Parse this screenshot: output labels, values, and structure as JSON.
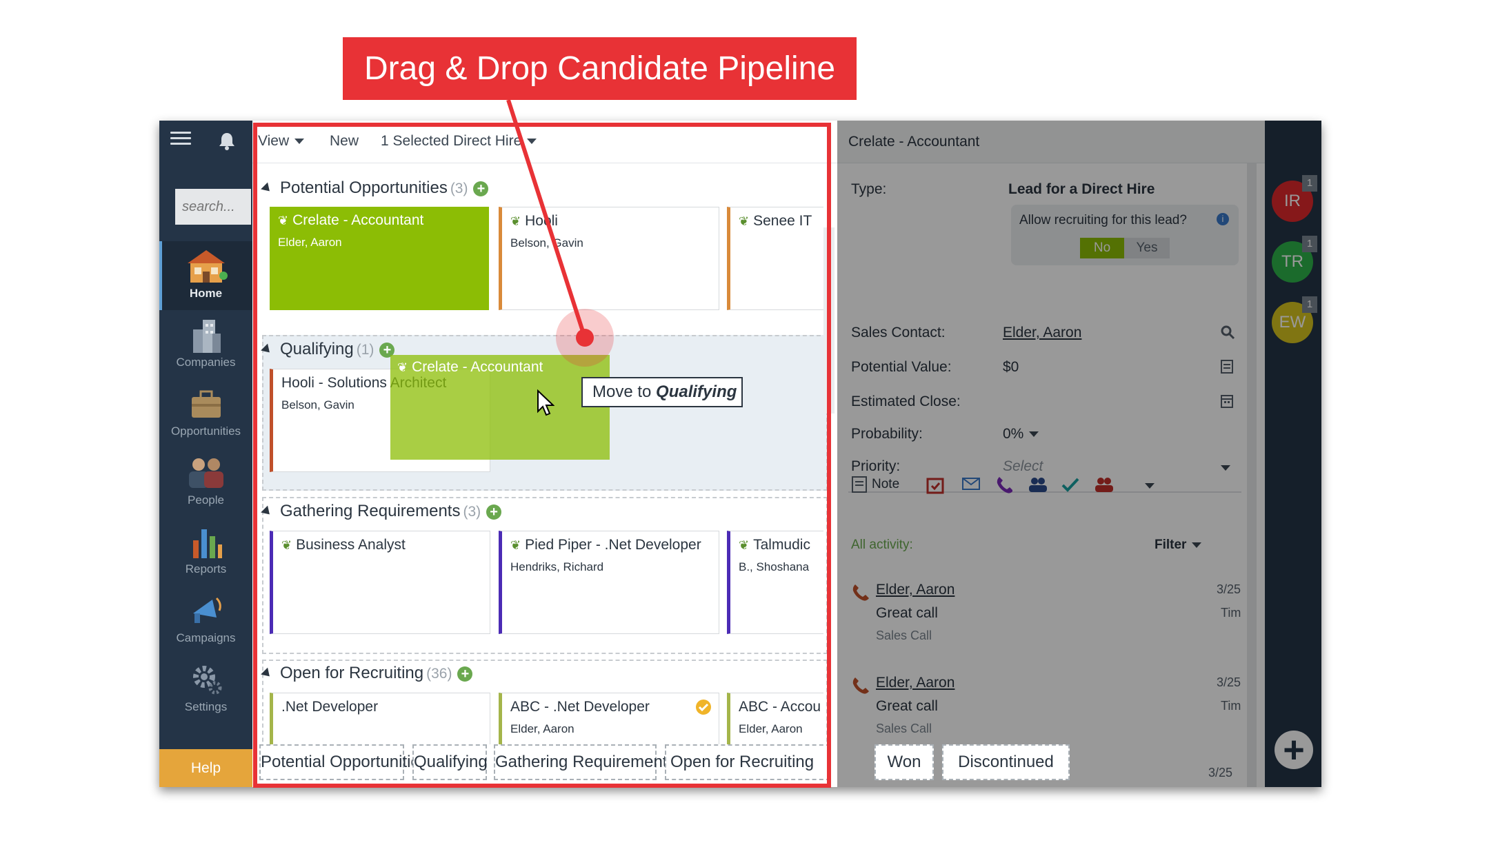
{
  "annotation": {
    "banner": "Drag & Drop Candidate Pipeline"
  },
  "nav": {
    "search_placeholder": "search...",
    "items": [
      {
        "label": "Home",
        "icon": "home-icon"
      },
      {
        "label": "Companies",
        "icon": "buildings-icon"
      },
      {
        "label": "Opportunities",
        "icon": "briefcase-icon"
      },
      {
        "label": "People",
        "icon": "people-icon"
      },
      {
        "label": "Reports",
        "icon": "bar-chart-icon"
      },
      {
        "label": "Campaigns",
        "icon": "megaphone-icon"
      },
      {
        "label": "Settings",
        "icon": "gear-icon"
      }
    ],
    "help": "Help"
  },
  "toolbar": {
    "view": "View",
    "new": "New",
    "selected": "1 Selected Direct Hire"
  },
  "stages": [
    {
      "name": "Potential Opportunities",
      "count": "(3)",
      "cards": [
        {
          "title": "Crelate - Accountant",
          "subtitle": "Elder, Aaron"
        },
        {
          "title": "Hooli",
          "subtitle": "Belson, Gavin"
        },
        {
          "title": "Senee IT",
          "subtitle": ""
        }
      ]
    },
    {
      "name": "Qualifying",
      "count": "(1)",
      "cards": [
        {
          "title": "Hooli - Solutions Architect",
          "subtitle": "Belson, Gavin"
        }
      ]
    },
    {
      "name": "Gathering Requirements",
      "count": "(3)",
      "cards": [
        {
          "title": "Business Analyst",
          "subtitle": ""
        },
        {
          "title": "Pied Piper - .Net Developer",
          "subtitle": "Hendriks, Richard"
        },
        {
          "title": "Talmudic",
          "subtitle": "B., Shoshana"
        }
      ]
    },
    {
      "name": "Open for Recruiting",
      "count": "(36)",
      "cards": [
        {
          "title": ".Net Developer",
          "subtitle": ""
        },
        {
          "title": "ABC - .Net Developer",
          "subtitle": "Elder, Aaron"
        },
        {
          "title": "ABC - Accou",
          "subtitle": "Elder, Aaron"
        }
      ]
    }
  ],
  "drag": {
    "title": "Crelate - Accountant",
    "tooltip_prefix": "Move to",
    "tooltip_target": "Qualifying"
  },
  "stagebar": [
    "Potential Opportunities",
    "Qualifying",
    "Gathering Requirements",
    "Open for Recruiting",
    "Won",
    "Discontinued"
  ],
  "detail": {
    "title": "Crelate - Accountant",
    "type_label": "Type:",
    "type_value": "Lead for a Direct Hire",
    "allow_label": "Allow recruiting for this lead?",
    "no": "No",
    "yes": "Yes",
    "fields": [
      {
        "label": "Sales Contact:",
        "value": "Elder, Aaron"
      },
      {
        "label": "Potential Value:",
        "value": "$0"
      },
      {
        "label": "Estimated Close:",
        "value": ""
      },
      {
        "label": "Probability:",
        "value": "0%"
      },
      {
        "label": "Priority:",
        "value": "Select"
      }
    ],
    "note": "Note",
    "all_activity": "All activity:",
    "filter": "Filter",
    "activities": [
      {
        "who": "Elder, Aaron",
        "desc": "Great call",
        "type": "Sales Call",
        "date": "3/25",
        "by": "Tim"
      },
      {
        "who": "Elder, Aaron",
        "desc": "Great call",
        "type": "Sales Call",
        "date": "3/25",
        "by": "Tim"
      }
    ],
    "peek_date": "3/25"
  },
  "rightrail": {
    "avatars": [
      {
        "initials": "IR",
        "badge": "1",
        "color": "#e0292c"
      },
      {
        "initials": "TR",
        "badge": "1",
        "color": "#2db34a"
      },
      {
        "initials": "EW",
        "badge": "1",
        "color": "#d6c31f"
      }
    ]
  },
  "colors": {
    "accent_green": "#8cbd05",
    "annotation_red": "#e83236",
    "nav_bg": "#243447"
  }
}
